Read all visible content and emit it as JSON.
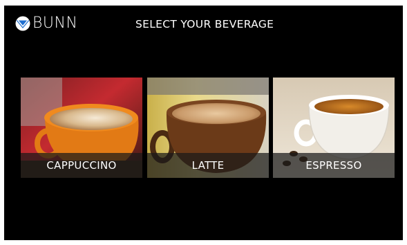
{
  "header": {
    "brand": "BUNN",
    "title": "SELECT YOUR BEVERAGE"
  },
  "beverages": [
    {
      "label": "CAPPUCCINO",
      "cup_color": "#e27a15"
    },
    {
      "label": "LATTE",
      "cup_color": "#6b3a18"
    },
    {
      "label": "ESPRESSO",
      "cup_color": "#f2efe9"
    }
  ],
  "colors": {
    "background": "#000000",
    "brand_blue": "#1f6fd0",
    "text": "#ffffff"
  }
}
